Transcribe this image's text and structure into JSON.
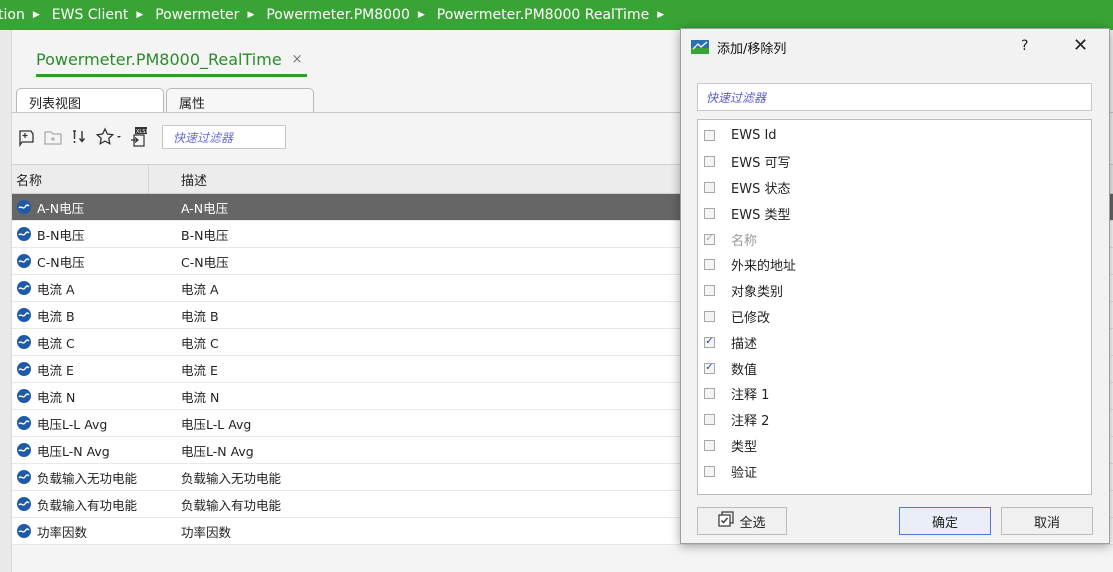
{
  "breadcrumb": {
    "items": [
      "tion",
      "EWS Client",
      "Powermeter",
      "Powermeter.PM8000",
      "Powermeter.PM8000 RealTime"
    ]
  },
  "document_tab": {
    "label": "Powermeter.PM8000_RealTime",
    "close_glyph": "×"
  },
  "view_tabs": [
    "列表视图",
    "属性"
  ],
  "toolbar": {
    "filter_placeholder": "快速过滤器"
  },
  "grid": {
    "columns": [
      "名称",
      "描述"
    ],
    "rows": [
      {
        "name": "A-N电压",
        "desc": "A-N电压",
        "selected": true
      },
      {
        "name": "B-N电压",
        "desc": "B-N电压"
      },
      {
        "name": "C-N电压",
        "desc": "C-N电压"
      },
      {
        "name": "电流 A",
        "desc": "电流 A"
      },
      {
        "name": "电流 B",
        "desc": "电流 B"
      },
      {
        "name": "电流 C",
        "desc": "电流 C"
      },
      {
        "name": "电流 E",
        "desc": "电流 E"
      },
      {
        "name": "电流 N",
        "desc": "电流 N"
      },
      {
        "name": "电压L-L Avg",
        "desc": "电压L-L Avg"
      },
      {
        "name": "电压L-N Avg",
        "desc": "电压L-N Avg"
      },
      {
        "name": "负载输入无功电能",
        "desc": "负载输入无功电能"
      },
      {
        "name": "负载输入有功电能",
        "desc": "负载输入有功电能"
      },
      {
        "name": "功率因数",
        "desc": "功率因数"
      }
    ]
  },
  "dialog": {
    "title": "添加/移除列",
    "help": "?",
    "close": "✕",
    "filter_placeholder": "快速过滤器",
    "options": [
      {
        "label": "EWS Id",
        "checked": false
      },
      {
        "label": "EWS 可写",
        "checked": false
      },
      {
        "label": "EWS 状态",
        "checked": false
      },
      {
        "label": "EWS 类型",
        "checked": false
      },
      {
        "label": "名称",
        "checked": true,
        "disabled": true
      },
      {
        "label": "外来的地址",
        "checked": false
      },
      {
        "label": "对象类别",
        "checked": false
      },
      {
        "label": "已修改",
        "checked": false
      },
      {
        "label": "描述",
        "checked": true
      },
      {
        "label": "数值",
        "checked": true
      },
      {
        "label": "注释 1",
        "checked": false
      },
      {
        "label": "注释 2",
        "checked": false
      },
      {
        "label": "类型",
        "checked": false
      },
      {
        "label": "验证",
        "checked": false
      }
    ],
    "select_all": "全选",
    "ok": "确定",
    "cancel": "取消"
  },
  "colors": {
    "accent_green": "#3aa335",
    "selected_row": "#666666",
    "primary_border": "#4b7ad0"
  }
}
